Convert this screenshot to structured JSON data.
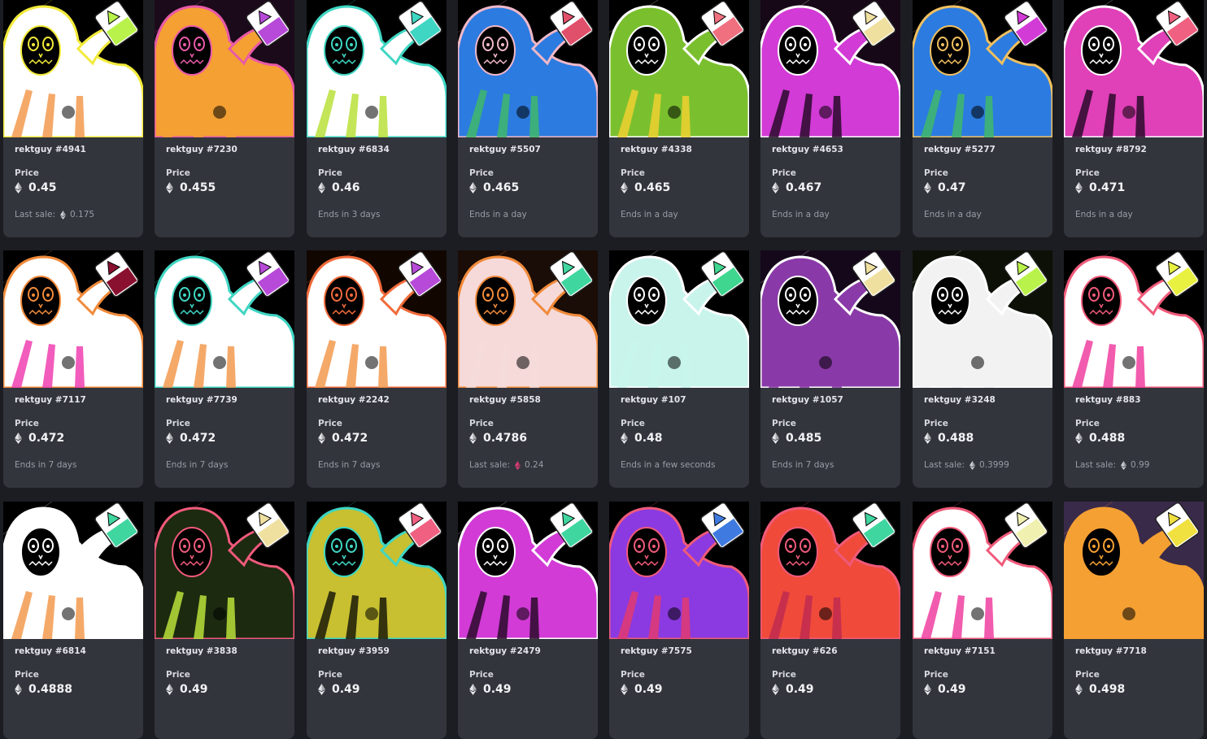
{
  "price_label": "Price",
  "last_sale_label": "Last sale:",
  "items": [
    {
      "name": "rektguy #4941",
      "price": "0.45",
      "footer_type": "last_sale",
      "footer_value": "0.175",
      "last_sale_eth_color": "#cfd2d8",
      "bg": "#000000",
      "hood": "#ffffff",
      "outline": "#f2ea3a",
      "stripe": "#f39a4f",
      "bottle": "#ffffff",
      "liquid": "#b9f24a"
    },
    {
      "name": "rektguy #7230",
      "price": "0.455",
      "footer_type": "none",
      "footer_value": "",
      "bg": "#1b0a1a",
      "hood": "#f5a033",
      "outline": "#e85aa8",
      "stripe": "#f5a033",
      "bottle": "#ffffff",
      "liquid": "#b74ad8"
    },
    {
      "name": "rektguy #6834",
      "price": "0.46",
      "footer_type": "text",
      "footer_value": "Ends in 3 days",
      "bg": "#000000",
      "hood": "#ffffff",
      "outline": "#3fd6c3",
      "stripe": "#b8e03a",
      "bottle": "#ffffff",
      "liquid": "#3fd6c3"
    },
    {
      "name": "rektguy #5507",
      "price": "0.465",
      "footer_type": "text",
      "footer_value": "Ends in a day",
      "bg": "#000000",
      "hood": "#2c7be0",
      "outline": "#f0b8c8",
      "stripe": "#3fb86a",
      "bottle": "#ffffff",
      "liquid": "#e0506b"
    },
    {
      "name": "rektguy #4338",
      "price": "0.465",
      "footer_type": "text",
      "footer_value": "Ends in a day",
      "bg": "#000000",
      "hood": "#7ac02e",
      "outline": "#ffffff",
      "stripe": "#f0d030",
      "bottle": "#ffffff",
      "liquid": "#f07080"
    },
    {
      "name": "rektguy #4653",
      "price": "0.467",
      "footer_type": "text",
      "footer_value": "Ends in a day",
      "bg": "#160816",
      "hood": "#d23bd6",
      "outline": "#ffffff",
      "stripe": "#2a0a2a",
      "bottle": "#ffffff",
      "liquid": "#f0e0a0"
    },
    {
      "name": "rektguy #5277",
      "price": "0.47",
      "footer_type": "text",
      "footer_value": "Ends in a day",
      "bg": "#000000",
      "hood": "#2c7be0",
      "outline": "#f0c060",
      "stripe": "#3fb86a",
      "bottle": "#ffffff",
      "liquid": "#d23bd6"
    },
    {
      "name": "rektguy #8792",
      "price": "0.471",
      "footer_type": "text",
      "footer_value": "Ends in a day",
      "bg": "#000000",
      "hood": "#e040b8",
      "outline": "#ffffff",
      "stripe": "#2a0a2a",
      "bottle": "#ffffff",
      "liquid": "#f06080"
    },
    {
      "name": "rektguy #7117",
      "price": "0.472",
      "footer_type": "text",
      "footer_value": "Ends in 7 days",
      "bg": "#000000",
      "hood": "#ffffff",
      "outline": "#f08a3a",
      "stripe": "#f040b0",
      "bottle": "#ffffff",
      "liquid": "#8a1030"
    },
    {
      "name": "rektguy #7739",
      "price": "0.472",
      "footer_type": "text",
      "footer_value": "Ends in 7 days",
      "bg": "#000000",
      "hood": "#ffffff",
      "outline": "#3fd6c3",
      "stripe": "#f39a4f",
      "bottle": "#ffffff",
      "liquid": "#b74ad8"
    },
    {
      "name": "rektguy #2242",
      "price": "0.472",
      "footer_type": "text",
      "footer_value": "Ends in 7 days",
      "bg": "#120600",
      "hood": "#ffffff",
      "outline": "#f06a3a",
      "stripe": "#f39a4f",
      "bottle": "#ffffff",
      "liquid": "#b74ad8"
    },
    {
      "name": "rektguy #5858",
      "price": "0.4786",
      "footer_type": "last_sale",
      "footer_value": "0.24",
      "last_sale_eth_color": "#e0407a",
      "bg": "#1a0c06",
      "hood": "#f6dada",
      "outline": "#f08a3a",
      "stripe": "#f6dada",
      "bottle": "#ffffff",
      "liquid": "#3fd6a0"
    },
    {
      "name": "rektguy #107",
      "price": "0.48",
      "footer_type": "text",
      "footer_value": "Ends in a few seconds",
      "bg": "#000000",
      "hood": "#c8f4ec",
      "outline": "#ffffff",
      "stripe": "#c8f4ec",
      "bottle": "#ffffff",
      "liquid": "#3fd690"
    },
    {
      "name": "rektguy #1057",
      "price": "0.485",
      "footer_type": "text",
      "footer_value": "Ends in 7 days",
      "bg": "#14081a",
      "hood": "#8a3aa8",
      "outline": "#ffffff",
      "stripe": "#8a3aa8",
      "bottle": "#ffffff",
      "liquid": "#f0e0a0"
    },
    {
      "name": "rektguy #3248",
      "price": "0.488",
      "footer_type": "last_sale",
      "footer_value": "0.3999",
      "last_sale_eth_color": "#cfd2d8",
      "bg": "#0c1006",
      "hood": "#f2f2f2",
      "outline": "#ffffff",
      "stripe": "#f2f2f2",
      "bottle": "#ffffff",
      "liquid": "#b9f24a"
    },
    {
      "name": "rektguy #883",
      "price": "0.488",
      "footer_type": "last_sale",
      "footer_value": "0.99",
      "last_sale_eth_color": "#cfd2d8",
      "bg": "#000000",
      "hood": "#ffffff",
      "outline": "#f05a7a",
      "stripe": "#f040a0",
      "bottle": "#ffffff",
      "liquid": "#e8f040"
    },
    {
      "name": "rektguy #6814",
      "price": "0.4888",
      "footer_type": "none",
      "footer_value": "",
      "bg": "#000000",
      "hood": "#ffffff",
      "outline": "#ffffff",
      "stripe": "#f39a4f",
      "bottle": "#ffffff",
      "liquid": "#3fd6a0"
    },
    {
      "name": "rektguy #3838",
      "price": "0.49",
      "footer_type": "none",
      "footer_value": "",
      "bg": "#000000",
      "hood": "#1c2a10",
      "outline": "#f05a7a",
      "stripe": "#b8e03a",
      "bottle": "#ffffff",
      "liquid": "#f0e0a0"
    },
    {
      "name": "rektguy #3959",
      "price": "0.49",
      "footer_type": "none",
      "footer_value": "",
      "bg": "#000000",
      "hood": "#c8c030",
      "outline": "#3fd6c3",
      "stripe": "#1a1a08",
      "bottle": "#ffffff",
      "liquid": "#f06080"
    },
    {
      "name": "rektguy #2479",
      "price": "0.49",
      "footer_type": "none",
      "footer_value": "",
      "bg": "#000000",
      "hood": "#d23bd6",
      "outline": "#ffffff",
      "stripe": "#2a0a2a",
      "bottle": "#ffffff",
      "liquid": "#3fd6a0"
    },
    {
      "name": "rektguy #7575",
      "price": "0.49",
      "footer_type": "none",
      "footer_value": "",
      "bg": "#000000",
      "hood": "#8a3ae0",
      "outline": "#f05a7a",
      "stripe": "#e03a70",
      "bottle": "#ffffff",
      "liquid": "#3f7ae0"
    },
    {
      "name": "rektguy #626",
      "price": "0.49",
      "footer_type": "none",
      "footer_value": "",
      "bg": "#000000",
      "hood": "#f04a3a",
      "outline": "#f05a7a",
      "stripe": "#c02a50",
      "bottle": "#ffffff",
      "liquid": "#3fd6a0"
    },
    {
      "name": "rektguy #7151",
      "price": "0.49",
      "footer_type": "none",
      "footer_value": "",
      "bg": "#000000",
      "hood": "#ffffff",
      "outline": "#f05a7a",
      "stripe": "#f040a0",
      "bottle": "#ffffff",
      "liquid": "#f0f0b0"
    },
    {
      "name": "rektguy #7718",
      "price": "0.498",
      "footer_type": "none",
      "footer_value": "",
      "bg": "#3a2a4a",
      "hood": "#f5a033",
      "outline": "#f5a033",
      "stripe": "#f5a033",
      "bottle": "#ffffff",
      "liquid": "#f0e040"
    }
  ]
}
